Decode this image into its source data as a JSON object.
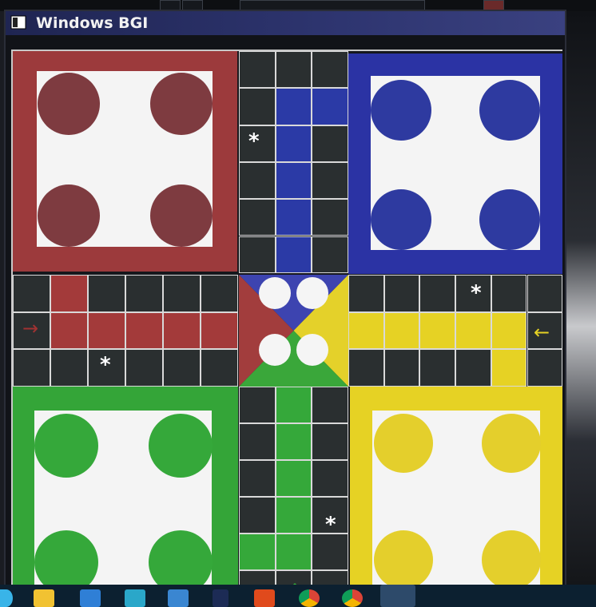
{
  "window": {
    "title": "Windows BGI"
  },
  "colors": {
    "red": "#a33a3a",
    "blue": "#2b3aa6",
    "green": "#35a83a",
    "yellow": "#e6d224",
    "dark_cell": "#2a2f30",
    "home_inner": "#f4f4f4"
  },
  "board": {
    "homes": [
      "red",
      "blue",
      "green",
      "yellow"
    ],
    "tokens_per_home": 4,
    "safe_star_glyph": "*",
    "red_entry_arrow": "→",
    "yellow_entry_arrow": "←",
    "green_entry_arrow": "↑"
  },
  "taskbar": {
    "icons": [
      "windows-start-icon",
      "file-explorer-icon",
      "store-icon",
      "app-icon",
      "mail-icon",
      "shortcut-icon",
      "office-icon",
      "chrome-icon",
      "chrome-profile-icon",
      "active-app-icon"
    ]
  }
}
